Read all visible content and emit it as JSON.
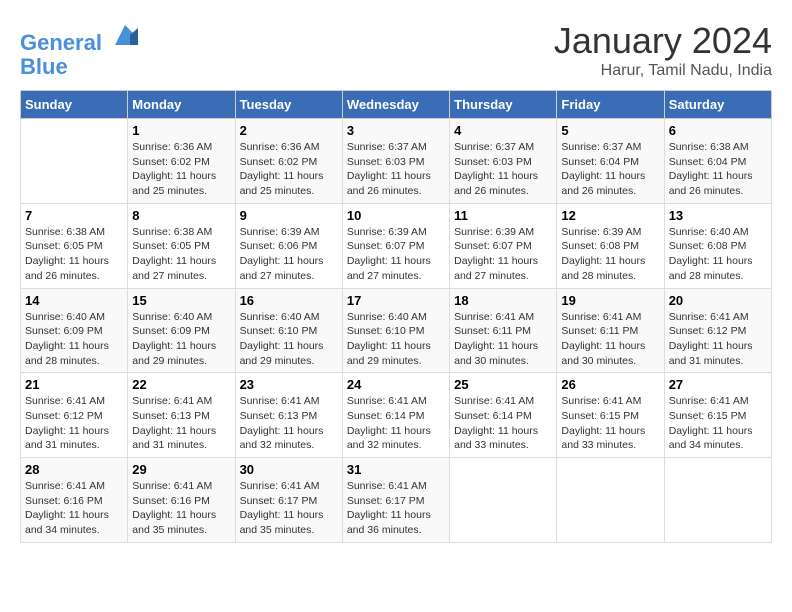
{
  "header": {
    "logo_line1": "General",
    "logo_line2": "Blue",
    "month_title": "January 2024",
    "location": "Harur, Tamil Nadu, India"
  },
  "columns": [
    "Sunday",
    "Monday",
    "Tuesday",
    "Wednesday",
    "Thursday",
    "Friday",
    "Saturday"
  ],
  "weeks": [
    [
      {
        "day": "",
        "detail": ""
      },
      {
        "day": "1",
        "detail": "Sunrise: 6:36 AM\nSunset: 6:02 PM\nDaylight: 11 hours\nand 25 minutes."
      },
      {
        "day": "2",
        "detail": "Sunrise: 6:36 AM\nSunset: 6:02 PM\nDaylight: 11 hours\nand 25 minutes."
      },
      {
        "day": "3",
        "detail": "Sunrise: 6:37 AM\nSunset: 6:03 PM\nDaylight: 11 hours\nand 26 minutes."
      },
      {
        "day": "4",
        "detail": "Sunrise: 6:37 AM\nSunset: 6:03 PM\nDaylight: 11 hours\nand 26 minutes."
      },
      {
        "day": "5",
        "detail": "Sunrise: 6:37 AM\nSunset: 6:04 PM\nDaylight: 11 hours\nand 26 minutes."
      },
      {
        "day": "6",
        "detail": "Sunrise: 6:38 AM\nSunset: 6:04 PM\nDaylight: 11 hours\nand 26 minutes."
      }
    ],
    [
      {
        "day": "7",
        "detail": "Sunrise: 6:38 AM\nSunset: 6:05 PM\nDaylight: 11 hours\nand 26 minutes."
      },
      {
        "day": "8",
        "detail": "Sunrise: 6:38 AM\nSunset: 6:05 PM\nDaylight: 11 hours\nand 27 minutes."
      },
      {
        "day": "9",
        "detail": "Sunrise: 6:39 AM\nSunset: 6:06 PM\nDaylight: 11 hours\nand 27 minutes."
      },
      {
        "day": "10",
        "detail": "Sunrise: 6:39 AM\nSunset: 6:07 PM\nDaylight: 11 hours\nand 27 minutes."
      },
      {
        "day": "11",
        "detail": "Sunrise: 6:39 AM\nSunset: 6:07 PM\nDaylight: 11 hours\nand 27 minutes."
      },
      {
        "day": "12",
        "detail": "Sunrise: 6:39 AM\nSunset: 6:08 PM\nDaylight: 11 hours\nand 28 minutes."
      },
      {
        "day": "13",
        "detail": "Sunrise: 6:40 AM\nSunset: 6:08 PM\nDaylight: 11 hours\nand 28 minutes."
      }
    ],
    [
      {
        "day": "14",
        "detail": "Sunrise: 6:40 AM\nSunset: 6:09 PM\nDaylight: 11 hours\nand 28 minutes."
      },
      {
        "day": "15",
        "detail": "Sunrise: 6:40 AM\nSunset: 6:09 PM\nDaylight: 11 hours\nand 29 minutes."
      },
      {
        "day": "16",
        "detail": "Sunrise: 6:40 AM\nSunset: 6:10 PM\nDaylight: 11 hours\nand 29 minutes."
      },
      {
        "day": "17",
        "detail": "Sunrise: 6:40 AM\nSunset: 6:10 PM\nDaylight: 11 hours\nand 29 minutes."
      },
      {
        "day": "18",
        "detail": "Sunrise: 6:41 AM\nSunset: 6:11 PM\nDaylight: 11 hours\nand 30 minutes."
      },
      {
        "day": "19",
        "detail": "Sunrise: 6:41 AM\nSunset: 6:11 PM\nDaylight: 11 hours\nand 30 minutes."
      },
      {
        "day": "20",
        "detail": "Sunrise: 6:41 AM\nSunset: 6:12 PM\nDaylight: 11 hours\nand 31 minutes."
      }
    ],
    [
      {
        "day": "21",
        "detail": "Sunrise: 6:41 AM\nSunset: 6:12 PM\nDaylight: 11 hours\nand 31 minutes."
      },
      {
        "day": "22",
        "detail": "Sunrise: 6:41 AM\nSunset: 6:13 PM\nDaylight: 11 hours\nand 31 minutes."
      },
      {
        "day": "23",
        "detail": "Sunrise: 6:41 AM\nSunset: 6:13 PM\nDaylight: 11 hours\nand 32 minutes."
      },
      {
        "day": "24",
        "detail": "Sunrise: 6:41 AM\nSunset: 6:14 PM\nDaylight: 11 hours\nand 32 minutes."
      },
      {
        "day": "25",
        "detail": "Sunrise: 6:41 AM\nSunset: 6:14 PM\nDaylight: 11 hours\nand 33 minutes."
      },
      {
        "day": "26",
        "detail": "Sunrise: 6:41 AM\nSunset: 6:15 PM\nDaylight: 11 hours\nand 33 minutes."
      },
      {
        "day": "27",
        "detail": "Sunrise: 6:41 AM\nSunset: 6:15 PM\nDaylight: 11 hours\nand 34 minutes."
      }
    ],
    [
      {
        "day": "28",
        "detail": "Sunrise: 6:41 AM\nSunset: 6:16 PM\nDaylight: 11 hours\nand 34 minutes."
      },
      {
        "day": "29",
        "detail": "Sunrise: 6:41 AM\nSunset: 6:16 PM\nDaylight: 11 hours\nand 35 minutes."
      },
      {
        "day": "30",
        "detail": "Sunrise: 6:41 AM\nSunset: 6:17 PM\nDaylight: 11 hours\nand 35 minutes."
      },
      {
        "day": "31",
        "detail": "Sunrise: 6:41 AM\nSunset: 6:17 PM\nDaylight: 11 hours\nand 36 minutes."
      },
      {
        "day": "",
        "detail": ""
      },
      {
        "day": "",
        "detail": ""
      },
      {
        "day": "",
        "detail": ""
      }
    ]
  ]
}
